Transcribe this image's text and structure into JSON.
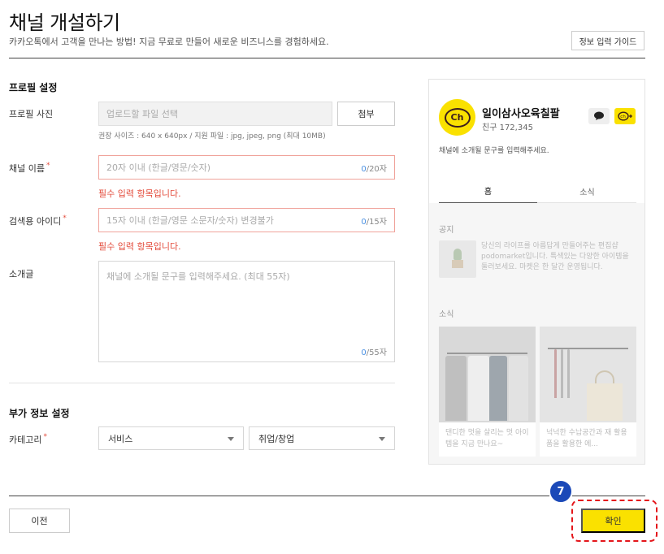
{
  "header": {
    "title": "채널 개설하기",
    "description": "카카오톡에서 고객을 만나는 방법! 지금 무료로 만들어 새로운 비즈니스를 경험하세요.",
    "guide_button": "정보 입력 가이드"
  },
  "profile": {
    "section_title": "프로필 설정",
    "photo": {
      "label": "프로필 사진",
      "placeholder": "업로드할 파일 선택",
      "attach_button": "첨부",
      "hint": "권장 사이즈 : 640 x 640px / 지원 파일 : jpg, jpeg, png (최대 10MB)"
    },
    "channel_name": {
      "label": "채널 이름",
      "required_mark": "*",
      "placeholder": "20자 이내 (한글/영문/숫자)",
      "count": "0",
      "max": "/20자",
      "error": "필수 입력 항목입니다."
    },
    "search_id": {
      "label": "검색용 아이디",
      "required_mark": "*",
      "placeholder": "15자 이내 (한글/영문 소문자/숫자) 변경불가",
      "count": "0",
      "max": "/15자",
      "error": "필수 입력 항목입니다."
    },
    "intro": {
      "label": "소개글",
      "placeholder": "채널에 소개될 문구를 입력해주세요. (최대 55자)",
      "count": "0",
      "max": "/55자"
    }
  },
  "extra": {
    "section_title": "부가 정보 설정",
    "category": {
      "label": "카테고리",
      "required_mark": "*",
      "primary": "서비스",
      "secondary": "취업/창업"
    }
  },
  "preview": {
    "avatar_text": "Ch",
    "channel_name": "일이삼사오육칠팔",
    "friends": "친구 172,345",
    "description": "채널에 소개될 문구를 입력해주세요.",
    "tabs": [
      "홈",
      "소식"
    ],
    "notice_title": "공지",
    "notice_text": "당신의 라이프를 아름답게 만들어주는 편집샵 podomarket입니다. 특색있는 다양한 아이템을 둘러보세요. 마켓은 한 달간 운영됩니다.",
    "news_title": "소식",
    "news": [
      {
        "text": "댄디한 멋을 살리는 멋 아이템을 지금 만나요~"
      },
      {
        "text": "넉넉한 수납공간과 재 활용품을 활용한 에..."
      }
    ]
  },
  "footer": {
    "prev_button": "이전",
    "confirm_button": "확인",
    "step_badge": "7"
  },
  "colors": {
    "kakao_yellow": "#fae100",
    "error_red": "#e34c3c",
    "highlight_red": "#e4161b",
    "badge_blue": "#1b49b8"
  }
}
